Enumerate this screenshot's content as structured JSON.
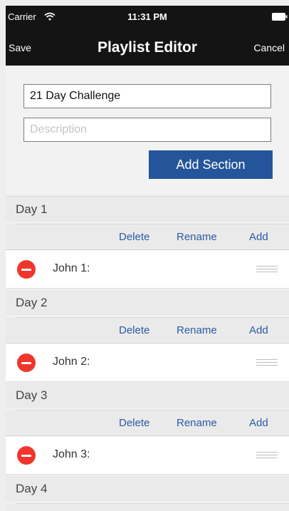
{
  "status": {
    "carrier": "Carrier",
    "time": "11:31 PM"
  },
  "nav": {
    "save": "Save",
    "title": "Playlist Editor",
    "cancel": "Cancel"
  },
  "form": {
    "title_value": "21 Day Challenge",
    "description_placeholder": "Description",
    "add_section_label": "Add Section"
  },
  "actions": {
    "delete": "Delete",
    "rename": "Rename",
    "add": "Add"
  },
  "sections": [
    {
      "title": "Day 1",
      "items": [
        "John 1:"
      ]
    },
    {
      "title": "Day 2",
      "items": [
        "John 2:"
      ]
    },
    {
      "title": "Day 3",
      "items": [
        "John 3:"
      ]
    },
    {
      "title": "Day 4",
      "items": []
    }
  ],
  "icons": [
    "wifi-icon",
    "battery-icon",
    "minus-icon",
    "reorder-icon"
  ],
  "colors": {
    "navbar": "#141414",
    "accent": "#24559a",
    "delete": "#f0362c",
    "link": "#2a5aa8"
  }
}
